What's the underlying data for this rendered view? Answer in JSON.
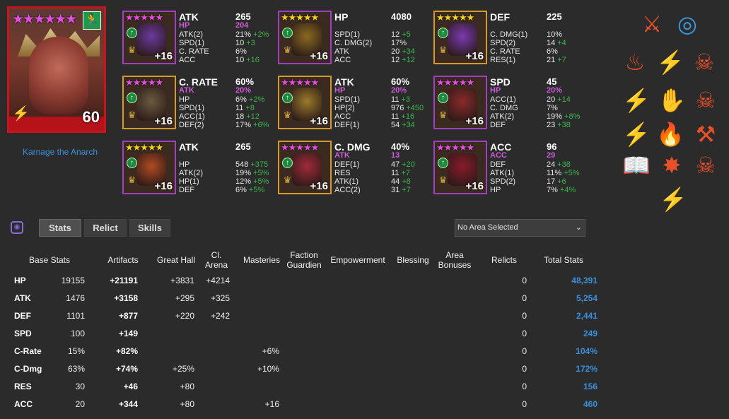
{
  "champion": {
    "name": "Karnage the Anarch",
    "level": "60",
    "stars": "★★★★★★"
  },
  "artifacts": [
    {
      "main": "ATK",
      "mainv": "265",
      "prim": "HP",
      "primv": "204",
      "level": "+16",
      "stars": "★★★★★",
      "ascended": true,
      "rarity": "epic",
      "color": "#6a3aa0",
      "subs": [
        {
          "n": "ATK(2)",
          "v": "21%",
          "b": "+2%"
        },
        {
          "n": "SPD(1)",
          "v": "10",
          "b": "+3"
        },
        {
          "n": "C. RATE",
          "v": "6%",
          "b": ""
        },
        {
          "n": "ACC",
          "v": "10",
          "b": "+16"
        }
      ]
    },
    {
      "main": "HP",
      "mainv": "4080",
      "prim": "",
      "primv": "",
      "level": "+16",
      "stars": "★★★★★",
      "ascended": false,
      "rarity": "epic",
      "color": "#8a6a20",
      "subs": [
        {
          "n": "SPD(1)",
          "v": "12",
          "b": "+5"
        },
        {
          "n": "C. DMG(2)",
          "v": "17%",
          "b": ""
        },
        {
          "n": "ATK",
          "v": "20",
          "b": "+34"
        },
        {
          "n": "ACC",
          "v": "12",
          "b": "+12"
        }
      ]
    },
    {
      "main": "DEF",
      "mainv": "225",
      "prim": "",
      "primv": "",
      "level": "+16",
      "stars": "★★★★★",
      "ascended": false,
      "rarity": "legendary",
      "color": "#7a3ab0",
      "subs": [
        {
          "n": "C. DMG(1)",
          "v": "10%",
          "b": ""
        },
        {
          "n": "SPD(2)",
          "v": "14",
          "b": "+4"
        },
        {
          "n": "C. RATE",
          "v": "6%",
          "b": ""
        },
        {
          "n": "RES(1)",
          "v": "21",
          "b": "+7"
        }
      ]
    },
    {
      "main": "C. RATE",
      "mainv": "60%",
      "prim": "ATK",
      "primv": "20%",
      "level": "+16",
      "stars": "★★★★★",
      "ascended": true,
      "rarity": "legendary",
      "color": "#6a5a40",
      "subs": [
        {
          "n": "HP",
          "v": "6%",
          "b": "+2%"
        },
        {
          "n": "SPD(1)",
          "v": "11",
          "b": "+8"
        },
        {
          "n": "ACC(1)",
          "v": "18",
          "b": "+12"
        },
        {
          "n": "DEF(2)",
          "v": "17%",
          "b": "+6%"
        }
      ]
    },
    {
      "main": "ATK",
      "mainv": "60%",
      "prim": "HP",
      "primv": "20%",
      "level": "+16",
      "stars": "★★★★★",
      "ascended": true,
      "rarity": "legendary",
      "color": "#9a7a2a",
      "subs": [
        {
          "n": "SPD(1)",
          "v": "11",
          "b": "+3"
        },
        {
          "n": "HP(2)",
          "v": "976",
          "b": "+450"
        },
        {
          "n": "ACC",
          "v": "11",
          "b": "+16"
        },
        {
          "n": "DEF(1)",
          "v": "54",
          "b": "+34"
        }
      ]
    },
    {
      "main": "SPD",
      "mainv": "45",
      "prim": "HP",
      "primv": "20%",
      "level": "+16",
      "stars": "★★★★★",
      "ascended": true,
      "rarity": "epic",
      "color": "#8a2a2a",
      "subs": [
        {
          "n": "ACC(1)",
          "v": "20",
          "b": "+14"
        },
        {
          "n": "C. DMG",
          "v": "7%",
          "b": ""
        },
        {
          "n": "ATK(2)",
          "v": "19%",
          "b": "+8%"
        },
        {
          "n": "DEF",
          "v": "23",
          "b": "+38"
        }
      ]
    },
    {
      "main": "ATK",
      "mainv": "265",
      "prim": "",
      "primv": "",
      "level": "+16",
      "stars": "★★★★★",
      "ascended": false,
      "rarity": "epic",
      "color": "#b04a20",
      "subs": [
        {
          "n": "HP",
          "v": "548",
          "b": "+375"
        },
        {
          "n": "ATK(2)",
          "v": "19%",
          "b": "+5%"
        },
        {
          "n": "HP(1)",
          "v": "12%",
          "b": "+5%"
        },
        {
          "n": "DEF",
          "v": "6%",
          "b": "+5%"
        }
      ]
    },
    {
      "main": "C. DMG",
      "mainv": "40%",
      "prim": "ATK",
      "primv": "13",
      "level": "+16",
      "stars": "★★★★★",
      "ascended": true,
      "rarity": "legendary",
      "color": "#a02a3a",
      "subs": [
        {
          "n": "DEF(1)",
          "v": "47",
          "b": "+20"
        },
        {
          "n": "RES",
          "v": "11",
          "b": "+7"
        },
        {
          "n": "ATK(1)",
          "v": "44",
          "b": "+8"
        },
        {
          "n": "ACC(2)",
          "v": "31",
          "b": "+7"
        }
      ]
    },
    {
      "main": "ACC",
      "mainv": "96",
      "prim": "ACC",
      "primv": "29",
      "level": "+16",
      "stars": "★★★★★",
      "ascended": true,
      "rarity": "epic",
      "color": "#8a1a2a",
      "subs": [
        {
          "n": "DEF",
          "v": "24",
          "b": "+38"
        },
        {
          "n": "ATK(1)",
          "v": "11%",
          "b": "+5%"
        },
        {
          "n": "SPD(2)",
          "v": "17",
          "b": "+6"
        },
        {
          "n": "HP",
          "v": "7%",
          "b": "+4%"
        }
      ]
    }
  ],
  "tabs": [
    "Stats",
    "Relict",
    "Skills"
  ],
  "area_select": "No Area Selected",
  "headers": [
    "Base Stats",
    "Artifacts",
    "Great Hall",
    "Cl. Arena",
    "Masteries",
    "Faction Guardien",
    "Empowerment",
    "Blessing",
    "Area Bonuses",
    "Relicts",
    "Total Stats"
  ],
  "rows": [
    {
      "label": "HP",
      "base": "19155",
      "art": "+21191",
      "hall": "+3831",
      "arena": "+4214",
      "mast": "",
      "relic": "0",
      "total": "48,391"
    },
    {
      "label": "ATK",
      "base": "1476",
      "art": "+3158",
      "hall": "+295",
      "arena": "+325",
      "mast": "",
      "relic": "0",
      "total": "5,254"
    },
    {
      "label": "DEF",
      "base": "1101",
      "art": "+877",
      "hall": "+220",
      "arena": "+242",
      "mast": "",
      "relic": "0",
      "total": "2,441"
    },
    {
      "label": "SPD",
      "base": "100",
      "art": "+149",
      "hall": "",
      "arena": "",
      "mast": "",
      "relic": "0",
      "total": "249"
    },
    {
      "label": "C-Rate",
      "base": "15%",
      "art": "+82%",
      "hall": "",
      "arena": "",
      "mast": "+6%",
      "relic": "0",
      "total": "104%"
    },
    {
      "label": "C-Dmg",
      "base": "63%",
      "art": "+74%",
      "hall": "+25%",
      "arena": "",
      "mast": "+10%",
      "relic": "0",
      "total": "172%"
    },
    {
      "label": "RES",
      "base": "30",
      "art": "+46",
      "hall": "+80",
      "arena": "",
      "mast": "",
      "relic": "0",
      "total": "156"
    },
    {
      "label": "ACC",
      "base": "20",
      "art": "+344",
      "hall": "+80",
      "arena": "",
      "mast": "+16",
      "relic": "0",
      "total": "460"
    }
  ],
  "skill_icons": [
    "sword-slash-icon",
    "spiral-strike-icon",
    "demon-fire-icon",
    "triple-slash-icon",
    "fanged-jaws-icon",
    "lightning-dash-icon",
    "hand-claw-icon",
    "biting-fangs-icon",
    "wind-gust-icon",
    "flame-spear-icon",
    "double-axe-icon",
    "open-book-icon",
    "blood-burst-icon",
    "skull-bite-icon",
    "split-spark-icon",
    "flaming-helm-icon"
  ],
  "colors": {
    "accent": "#3a90e0",
    "bonus": "#3ab84a",
    "primary_substat": "#d05bdc",
    "champion_frame": "#c8141c"
  }
}
